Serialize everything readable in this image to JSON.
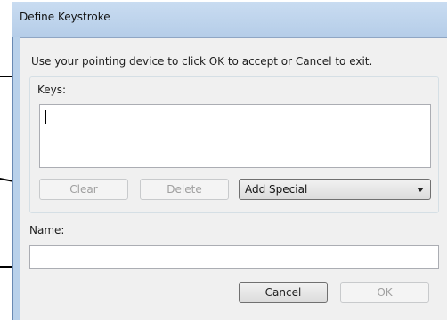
{
  "window": {
    "title": "Define Keystroke"
  },
  "instruction": "Use your pointing device to click OK to accept or Cancel to exit.",
  "keys": {
    "label": "Keys:",
    "value": ""
  },
  "buttons": {
    "clear": "Clear",
    "delete": "Delete",
    "cancel": "Cancel",
    "ok": "OK"
  },
  "add_special": {
    "selected": "Add Special"
  },
  "name": {
    "label": "Name:",
    "value": ""
  },
  "colors": {
    "frame": "#b9d1ea",
    "client": "#f0f0f0",
    "disabled_text": "#a0a0a0"
  }
}
